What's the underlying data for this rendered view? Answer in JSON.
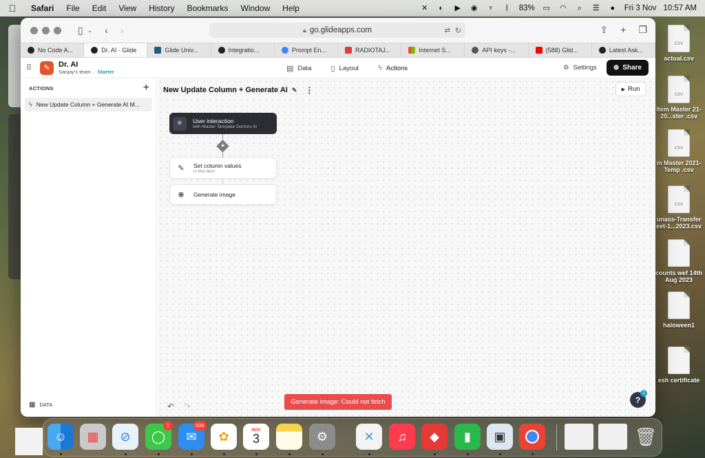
{
  "menubar": {
    "app": "Safari",
    "items": [
      "File",
      "Edit",
      "View",
      "History",
      "Bookmarks",
      "Window",
      "Help"
    ],
    "battery": "83%",
    "date": "Fri 3 Nov",
    "time": "10:57 AM"
  },
  "browser": {
    "url": "go.glideapps.com",
    "tabs": [
      {
        "label": "No Code A...",
        "color": "#222222"
      },
      {
        "label": "Dr. AI · Glide",
        "color": "#222222"
      },
      {
        "label": "Glide Univ...",
        "color": "#1f5f7a"
      },
      {
        "label": "Integratio...",
        "color": "#222222"
      },
      {
        "label": "Prompt En...",
        "color": "#4285f4"
      },
      {
        "label": "RADIOTAJ...",
        "color": "#e23b3b"
      },
      {
        "label": "Internet S...",
        "color": "#f25022"
      },
      {
        "label": "API keys -...",
        "color": "#555555"
      },
      {
        "label": "(588) Glid...",
        "color": "#ff0000"
      },
      {
        "label": "Latest Ask...",
        "color": "#222222"
      }
    ]
  },
  "app": {
    "name": "Dr. AI",
    "team": "Sanjay's team",
    "plan": "Starter",
    "nav": [
      {
        "label": "Data",
        "icon": "table-icon"
      },
      {
        "label": "Layout",
        "icon": "layout-icon"
      },
      {
        "label": "Actions",
        "icon": "bolt-icon"
      }
    ],
    "settings_label": "Settings",
    "share_label": "Share"
  },
  "sidebar": {
    "heading": "ACTIONS",
    "item": "New Update Column + Generate AI  M...",
    "footer": "DATA"
  },
  "workflow": {
    "title": "New Update Column + Generate AI",
    "run_label": "Run",
    "trigger": {
      "title": "User interaction",
      "subtitle": "with Master Template Doctors AI"
    },
    "steps": [
      {
        "title": "Set column values",
        "subtitle": "in this item"
      },
      {
        "title": "Generate image",
        "subtitle": ""
      }
    ],
    "toast": "Generate image: Could not fetch",
    "help_badge": "1"
  },
  "desktop": {
    "files": [
      {
        "name": "actual.csv",
        "tag": "CSV"
      },
      {
        "name": "Item Master 21-20...ster .csv",
        "tag": "CSV"
      },
      {
        "name": "m Master 2021-Temp .csv",
        "tag": "CSV"
      },
      {
        "name": "unass-Transfer eet-1...2023.csv",
        "tag": "CSV"
      },
      {
        "name": "counts wef 14th Aug 2023",
        "tag": ""
      },
      {
        "name": "haloween1",
        "tag": ""
      },
      {
        "name": "esh certificate",
        "tag": ""
      }
    ]
  },
  "dock": {
    "calendar_month": "NOV",
    "calendar_day": "3",
    "messages_badge": "1",
    "mail_badge": "538"
  }
}
